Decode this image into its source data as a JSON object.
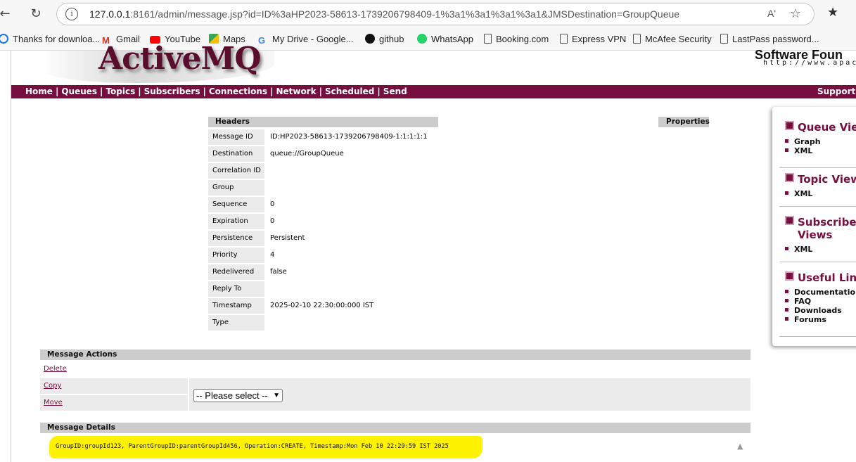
{
  "browser": {
    "url_host": "127.0.0.1",
    "url_rest": ":8161/admin/message.jsp?id=ID%3aHP2023-58613-1739206798409-1%3a1%3a1%3a1%3a1&JMSDestination=GroupQueue",
    "read_aloud": "Aʹ"
  },
  "bookmarks": [
    {
      "label": "Thanks for downloa...",
      "icon": "ie-icon",
      "color": "#1a73e8"
    },
    {
      "label": "Gmail",
      "icon": "gmail-icon",
      "color": "#d93025"
    },
    {
      "label": "YouTube",
      "icon": "youtube-icon",
      "color": "#ff0000"
    },
    {
      "label": "Maps",
      "icon": "maps-icon",
      "color": "#34a853"
    },
    {
      "label": "My Drive - Google...",
      "icon": "google-icon",
      "color": "#4285f4"
    },
    {
      "label": "github",
      "icon": "github-icon",
      "color": "#111111"
    },
    {
      "label": "WhatsApp",
      "icon": "whatsapp-icon",
      "color": "#25d366"
    },
    {
      "label": "Booking.com",
      "icon": "page-icon",
      "color": "#555555"
    },
    {
      "label": "Express VPN",
      "icon": "page-icon",
      "color": "#555555"
    },
    {
      "label": "McAfee Security",
      "icon": "page-icon",
      "color": "#555555"
    },
    {
      "label": "LastPass password...",
      "icon": "page-icon",
      "color": "#555555"
    }
  ],
  "logo": {
    "word": "ActiveMQ",
    "asf_title": "Software Foun",
    "asf_url": "http://www.apach"
  },
  "menu": {
    "items": [
      "Home",
      "Queues",
      "Topics",
      "Subscribers",
      "Connections",
      "Network",
      "Scheduled",
      "Send"
    ],
    "support": "Support"
  },
  "headers": {
    "title": "Headers",
    "properties_title": "Properties",
    "rows": [
      {
        "label": "Message ID",
        "value": "ID:HP2023-58613-1739206798409-1:1:1:1:1"
      },
      {
        "label": "Destination",
        "value": "queue://GroupQueue"
      },
      {
        "label": "Correlation ID",
        "value": ""
      },
      {
        "label": "Group",
        "value": ""
      },
      {
        "label": "Sequence",
        "value": "0"
      },
      {
        "label": "Expiration",
        "value": "0"
      },
      {
        "label": "Persistence",
        "value": "Persistent"
      },
      {
        "label": "Priority",
        "value": "4"
      },
      {
        "label": "Redelivered",
        "value": "false"
      },
      {
        "label": "Reply To",
        "value": ""
      },
      {
        "label": "Timestamp",
        "value": "2025-02-10 22:30:00:000 IST"
      },
      {
        "label": "Type",
        "value": ""
      }
    ]
  },
  "actions": {
    "title": "Message Actions",
    "delete": "Delete",
    "copy": "Copy",
    "move": "Move",
    "select_value": "-- Please select --"
  },
  "details": {
    "title": "Message Details",
    "text": "GroupID:groupId123, ParentGroupID:parentGroupId456, Operation:CREATE, Timestamp:Mon Feb 10 22:29:59 IST 2025",
    "highlight_color": "#fff200"
  },
  "side": {
    "sections": [
      {
        "title": "Queue Vie",
        "links": [
          "Graph",
          "XML"
        ]
      },
      {
        "title": "Topic View",
        "links": [
          "XML"
        ]
      },
      {
        "title": "Subscribe",
        "title2": "Views",
        "links": [
          "XML"
        ]
      },
      {
        "title": "Useful Lin",
        "links": [
          "Documentatio",
          "FAQ",
          "Downloads",
          "Forums"
        ]
      }
    ]
  },
  "theme": {
    "accent": "#760f3f",
    "header_grey": "#cccccc",
    "row_grey": "#ebebeb"
  }
}
